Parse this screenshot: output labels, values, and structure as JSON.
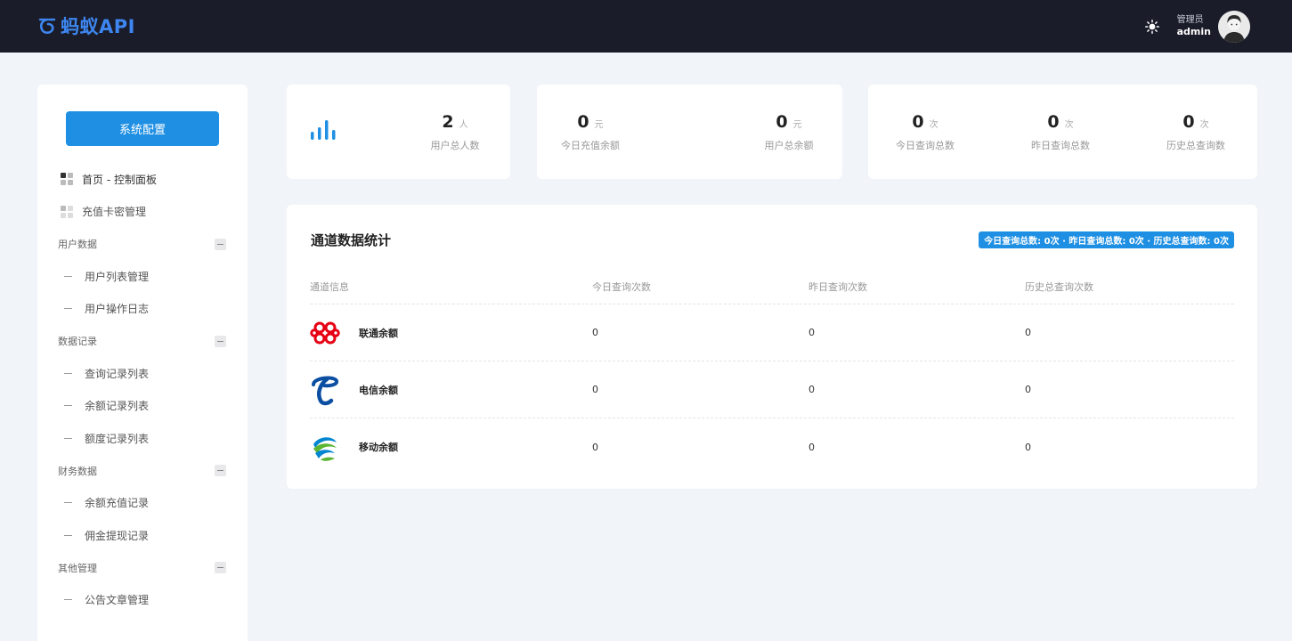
{
  "header": {
    "logo_text": "蚂蚁API",
    "user_role": "管理员",
    "user_name": "admin",
    "brand_color": "#3d86f0",
    "bg_color": "#1a1c29"
  },
  "sidebar": {
    "config_button": "系统配置",
    "top_items": [
      {
        "label": "首页 - 控制面板",
        "icon": "grid-icon"
      },
      {
        "label": "充值卡密管理",
        "icon": "grid-icon"
      }
    ],
    "groups": [
      {
        "title": "用户数据",
        "items": [
          "用户列表管理",
          "用户操作日志"
        ]
      },
      {
        "title": "数据记录",
        "items": [
          "查询记录列表",
          "余额记录列表",
          "额度记录列表"
        ]
      },
      {
        "title": "财务数据",
        "items": [
          "余额充值记录",
          "佣金提现记录"
        ]
      },
      {
        "title": "其他管理",
        "items": [
          "公告文章管理"
        ]
      }
    ]
  },
  "stats": {
    "users": {
      "value": "2",
      "unit": "人",
      "label": "用户总人数"
    },
    "today_recharge": {
      "value": "0",
      "unit": "元",
      "label": "今日充值余额"
    },
    "user_balance": {
      "value": "0",
      "unit": "元",
      "label": "用户总余额"
    },
    "today_queries": {
      "value": "0",
      "unit": "次",
      "label": "今日查询总数"
    },
    "yesterday_queries": {
      "value": "0",
      "unit": "次",
      "label": "昨日查询总数"
    },
    "history_queries": {
      "value": "0",
      "unit": "次",
      "label": "历史总查询数"
    }
  },
  "channel_panel": {
    "title": "通道数据统计",
    "summary": "今日查询总数: 0次 · 昨日查询总数: 0次 · 历史总查询数: 0次",
    "headers": [
      "通道信息",
      "今日查询次数",
      "昨日查询次数",
      "历史总查询次数"
    ],
    "rows": [
      {
        "name": "联通余额",
        "logo": "china-unicom-logo",
        "today": "0",
        "yesterday": "0",
        "history": "0"
      },
      {
        "name": "电信余额",
        "logo": "china-telecom-logo",
        "today": "0",
        "yesterday": "0",
        "history": "0"
      },
      {
        "name": "移动余额",
        "logo": "china-mobile-logo",
        "today": "0",
        "yesterday": "0",
        "history": "0"
      }
    ]
  },
  "accent_color": "#1e8fe3"
}
